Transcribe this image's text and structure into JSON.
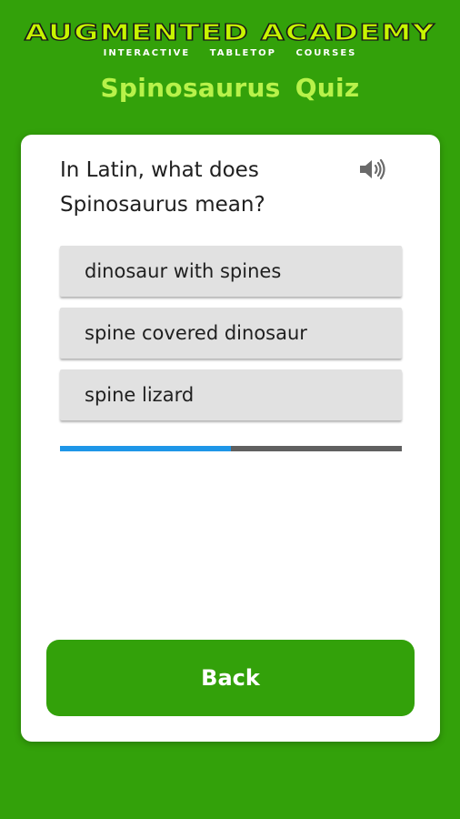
{
  "brand": {
    "title": "AUGMENTED ACADEMY",
    "subtitle": "INTERACTIVE TABLETOP COURSES"
  },
  "page": {
    "title": "Spinosaurus  Quiz"
  },
  "quiz": {
    "question": "In Latin, what does Spinosaurus mean?",
    "answers": [
      {
        "label": "dinosaur with spines"
      },
      {
        "label": "spine covered dinosaur"
      },
      {
        "label": "spine lizard"
      }
    ],
    "progress_fraction": 0.5
  },
  "actions": {
    "back_label": "Back"
  },
  "colors": {
    "background": "#33a10a",
    "title": "#b8f24a",
    "progress_fill": "#1e96e8",
    "progress_track": "#606060"
  },
  "icons": {
    "speaker": "speaker-icon"
  }
}
